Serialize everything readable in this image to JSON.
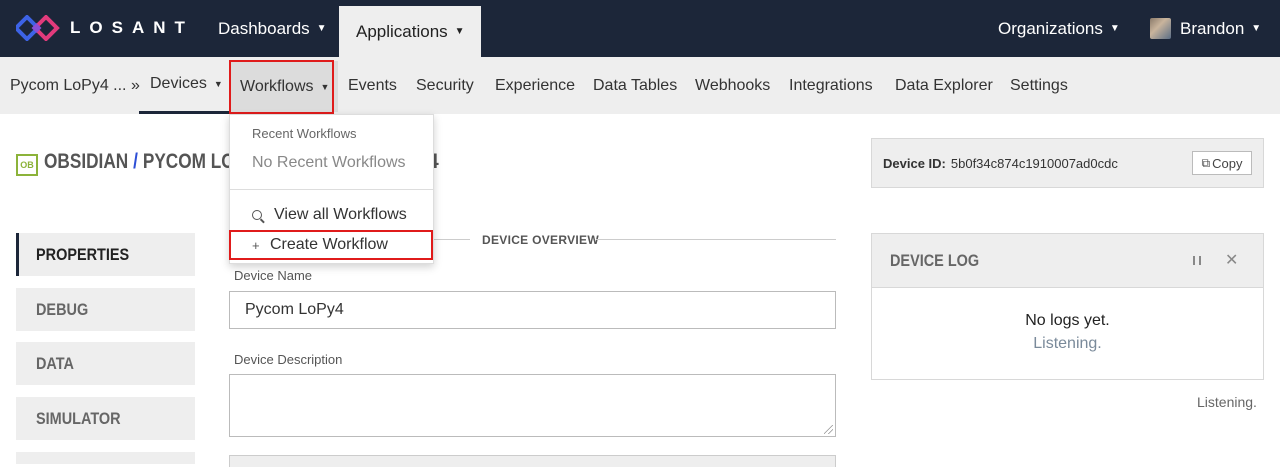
{
  "brand": {
    "name": "LOSANT"
  },
  "topnav": {
    "dashboards": "Dashboards",
    "applications": "Applications",
    "organizations": "Organizations",
    "user": "Brandon"
  },
  "subnav": {
    "app_name": "Pycom LoPy4 ... »",
    "items": [
      "Devices",
      "Workflows",
      "Events",
      "Security",
      "Experience",
      "Data Tables",
      "Webhooks",
      "Integrations",
      "Data Explorer",
      "Settings"
    ]
  },
  "dropdown": {
    "header": "Recent Workflows",
    "empty": "No Recent Workflows",
    "view_all": "View all Workflows",
    "create": "Create Workflow"
  },
  "title": {
    "badge": "OB",
    "org": "OBSIDIAN",
    "separator": "/",
    "device": "PYCOM LOP",
    "tail": "4"
  },
  "device_id": {
    "label": "Device ID:",
    "value": "5b0f34c874c1910007ad0cdc",
    "copy": "Copy"
  },
  "side_tabs": [
    "PROPERTIES",
    "DEBUG",
    "DATA",
    "SIMULATOR"
  ],
  "overview": {
    "label": "DEVICE OVERVIEW",
    "name_label": "Device Name",
    "name_value": "Pycom LoPy4",
    "desc_label": "Device Description",
    "desc_value": ""
  },
  "device_log": {
    "title": "DEVICE LOG",
    "empty": "No logs yet.",
    "listening": "Listening.",
    "footer_listening": "Listening."
  }
}
